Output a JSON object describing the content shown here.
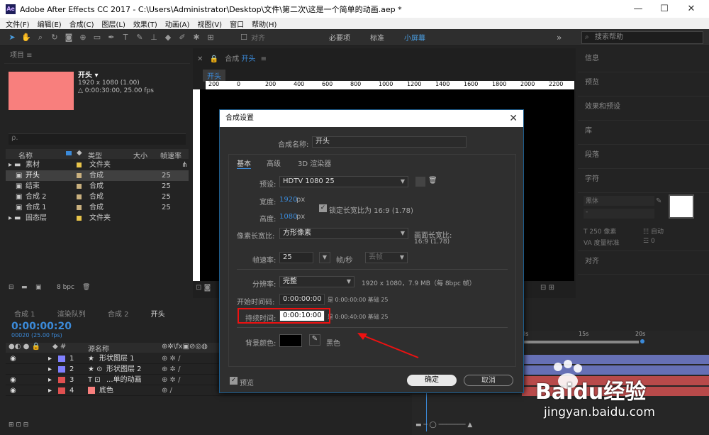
{
  "window": {
    "app_icon": "Ae",
    "title": "Adobe After Effects CC 2017 - C:\\Users\\Administrator\\Desktop\\文件\\第二次\\这是一个简单的动画.aep *"
  },
  "menu": [
    "文件(F)",
    "编辑(E)",
    "合成(C)",
    "图层(L)",
    "效果(T)",
    "动画(A)",
    "视图(V)",
    "窗口",
    "帮助(H)"
  ],
  "toolbar": {
    "snap_label": "对齐",
    "workspaces": [
      "必要项",
      "标准",
      "小屏幕"
    ],
    "more": "»",
    "search_placeholder": "搜索帮助"
  },
  "project": {
    "panel_title": "项目",
    "comp_name": "开头 ▾",
    "comp_dims": "1920 x 1080 (1.00)",
    "comp_duration": "△ 0:00:30:00, 25.00 fps",
    "search_icon_label": "ρ.",
    "columns": [
      "名称",
      "类型",
      "大小",
      "帧速率"
    ],
    "rows": [
      {
        "name": "素材",
        "type": "文件夹",
        "fps": ""
      },
      {
        "name": "开头",
        "type": "合成",
        "fps": "25"
      },
      {
        "name": "结束",
        "type": "合成",
        "fps": "25"
      },
      {
        "name": "合成 2",
        "type": "合成",
        "fps": "25"
      },
      {
        "name": "合成 1",
        "type": "合成",
        "fps": "25"
      },
      {
        "name": "固态层",
        "type": "文件夹",
        "fps": ""
      }
    ],
    "bpc": "8 bpc"
  },
  "viewer": {
    "tab_prefix": "合成",
    "tab_name": "开头",
    "breadcrumb": "开头",
    "ruler_ticks": [
      "200",
      "0",
      "200",
      "400",
      "600",
      "800",
      "1000",
      "1200",
      "1400",
      "1600",
      "1800",
      "2000",
      "2200"
    ]
  },
  "right_panel": {
    "items": [
      "信息",
      "预览",
      "效果和预设",
      "库",
      "段落",
      "字符"
    ],
    "font_placeholder": "黑体",
    "font_size": "250 像素",
    "leading": "自动",
    "tracking_label": "度量标准",
    "tracking": "0",
    "align": "对齐"
  },
  "timeline": {
    "tabs": [
      "合成 1",
      "渲染队列",
      "合成 2",
      "开头"
    ],
    "time": "0:00:00:20",
    "frames": "00020 (25.00 fps)",
    "col_name": "源名称",
    "layers": [
      {
        "num": "1",
        "name": "形状图层 1",
        "color": "#8080ff"
      },
      {
        "num": "2",
        "name": "形状图层 2",
        "color": "#8080ff"
      },
      {
        "num": "3",
        "name": "...单的动画",
        "color": "#e05050"
      },
      {
        "num": "4",
        "name": "底色",
        "color": "#e05050"
      }
    ],
    "ruler": [
      "0s",
      "15s",
      "20s"
    ]
  },
  "dialog": {
    "title": "合成设置",
    "name_label": "合成名称:",
    "name_value": "开头",
    "tabs": [
      "基本",
      "高级",
      "3D 渲染器"
    ],
    "preset_label": "预设:",
    "preset_value": "HDTV 1080 25",
    "width_label": "宽度:",
    "width_value": "1920",
    "height_label": "高度:",
    "height_value": "1080",
    "px": "px",
    "lock_label": "锁定长宽比为 16:9 (1.78)",
    "par_label": "像素长宽比:",
    "par_value": "方形像素",
    "frame_aspect_label": "画面长宽比:",
    "frame_aspect_value": "16:9 (1.78)",
    "fps_label": "帧速率:",
    "fps_value": "25",
    "fps_unit": "帧/秒",
    "drop_frame": "丢帧",
    "res_label": "分辨率:",
    "res_value": "完整",
    "res_info": "1920 x 1080，7.9 MB（每 8bpc 帧）",
    "start_label": "开始时间码:",
    "start_value": "0:00:00:00",
    "start_info": "是 0:00:00:00  基础 25",
    "dur_label": "持续时间:",
    "dur_value": "0:00:10:00",
    "dur_info": "是 0:00:40:00  基础 25",
    "bg_label": "背景颜色:",
    "bg_color_name": "黑色",
    "preview_label": "预览",
    "ok": "确定",
    "cancel": "取消"
  },
  "watermark": {
    "brand": "Baidu经验",
    "url": "jingyan.baidu.com"
  }
}
